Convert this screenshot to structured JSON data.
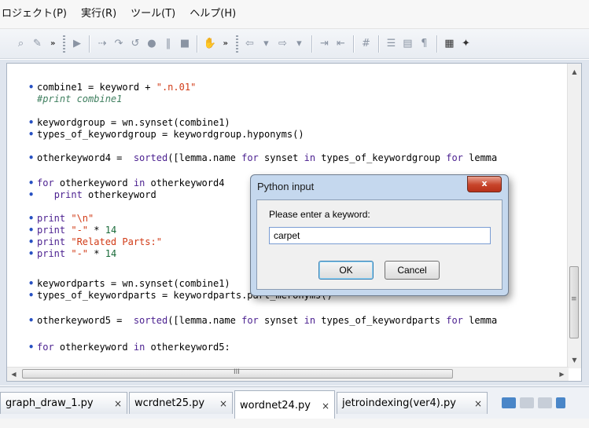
{
  "menubar": {
    "items": [
      "ロジェクト(P)",
      "実行(R)",
      "ツール(T)",
      "ヘルプ(H)"
    ]
  },
  "toolbar": {
    "icons": [
      "search-icon",
      "history-icon",
      "run-icon",
      "step-icon",
      "step-over-icon",
      "debug-icon",
      "breakpoint-icon",
      "stop-icon",
      "hand-icon",
      "back-icon",
      "forward-icon",
      "indent-icon",
      "outdent-icon",
      "comment-icon",
      "list-icon",
      "page-icon",
      "pilcrow-icon",
      "table-icon",
      "wizard-icon"
    ]
  },
  "editor": {
    "lines": [
      {
        "text": "combine1 = keyword + \".n.01\"",
        "bullet": true
      },
      {
        "text": "#print combine1",
        "bullet": false,
        "comment": true
      },
      {
        "text": "",
        "bullet": false
      },
      {
        "text": "keywordgroup = wn.synset(combine1)",
        "bullet": true
      },
      {
        "text": "types_of_keywordgroup = keywordgroup.hyponyms()",
        "bullet": true
      },
      {
        "text": "",
        "bullet": false
      },
      {
        "text": "otherkeyword4 =  sorted([lemma.name for synset in types_of_keywordgroup for lemma",
        "bullet": true
      },
      {
        "text": "",
        "bullet": false
      },
      {
        "text": "for otherkeyword in otherkeyword4",
        "bullet": true
      },
      {
        "text": "   print otherkeyword",
        "bullet": true
      },
      {
        "text": "",
        "bullet": false
      },
      {
        "text": "print \"\\n\"",
        "bullet": true
      },
      {
        "text": "print \"-\" * 14",
        "bullet": true
      },
      {
        "text": "print \"Related Parts:\"",
        "bullet": true
      },
      {
        "text": "print \"-\" * 14",
        "bullet": true
      },
      {
        "text": "",
        "bullet": false
      },
      {
        "text": "keywordparts = wn.synset(combine1)",
        "bullet": true
      },
      {
        "text": "types_of_keywordparts = keywordparts.part_meronyms()",
        "bullet": true
      },
      {
        "text": "",
        "bullet": false
      },
      {
        "text": "otherkeyword5 =  sorted([lemma.name for synset in types_of_keywordparts for lemma",
        "bullet": true
      },
      {
        "text": "",
        "bullet": false
      },
      {
        "text": "for otherkeyword in otherkeyword5:",
        "bullet": true
      }
    ],
    "hscroll_thumb_label": "III"
  },
  "tabs": [
    {
      "label": "graph_draw_1.py",
      "active": false
    },
    {
      "label": "wcrdnet25.py",
      "active": false
    },
    {
      "label": "wordnet24.py",
      "active": true
    },
    {
      "label": "jetroindexing(ver4).py",
      "active": false
    }
  ],
  "dialog": {
    "title": "Python input",
    "close_label": "x",
    "prompt": "Please enter a keyword:",
    "input_value": "carpet",
    "ok_label": "OK",
    "cancel_label": "Cancel"
  }
}
